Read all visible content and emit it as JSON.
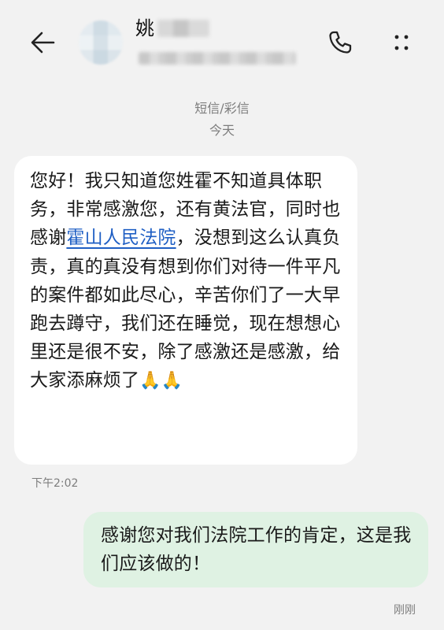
{
  "header": {
    "back_icon": "arrow-left-icon",
    "contact_name_visible": "姚",
    "call_icon": "phone-icon",
    "more_icon": "more-vertical-icon"
  },
  "conversation": {
    "service_label": "短信/彩信",
    "date_label": "今天"
  },
  "messages": [
    {
      "direction": "incoming",
      "text_before_link": "您好！我只知道您姓霍不知道具体职务，非常感激您，还有黄法官，同时也感谢",
      "link_text": "霍山人民法院",
      "text_after_link": "，没想到这么认真负责，真的真没有想到你们对待一件平凡的案件都如此尽心，辛苦你们了一大早跑去蹲守，我们还在睡觉，现在想想心里还是很不安，除了感激还是感激，给大家添麻烦了",
      "emoji": "🙏🙏",
      "time": "下午2:02"
    },
    {
      "direction": "outgoing",
      "text": "感谢您对我们法院工作的肯定，这是我们应该做的！",
      "time": "刚刚"
    }
  ],
  "colors": {
    "background": "#f2f2f2",
    "incoming_bubble": "#ffffff",
    "outgoing_bubble": "#dff2e3",
    "link": "#1f5fc4",
    "meta_text": "#7d7d7d"
  }
}
